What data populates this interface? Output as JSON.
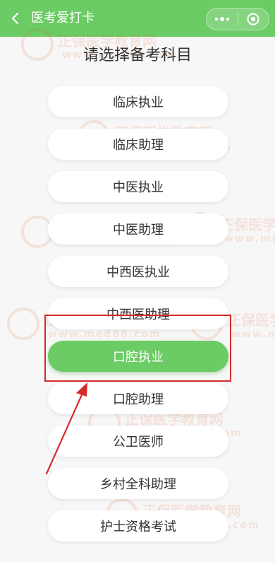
{
  "header": {
    "title": "医考爱打卡",
    "bg_color": "#6bcb64"
  },
  "page": {
    "heading": "请选择备考科目"
  },
  "watermark": {
    "line1": "正保医学教育网",
    "line2": "www.med66.com"
  },
  "subjects": [
    {
      "label": "临床执业",
      "selected": false
    },
    {
      "label": "临床助理",
      "selected": false
    },
    {
      "label": "中医执业",
      "selected": false
    },
    {
      "label": "中医助理",
      "selected": false
    },
    {
      "label": "中西医执业",
      "selected": false
    },
    {
      "label": "中西医助理",
      "selected": false
    },
    {
      "label": "口腔执业",
      "selected": true
    },
    {
      "label": "口腔助理",
      "selected": false
    },
    {
      "label": "公卫医师",
      "selected": false
    },
    {
      "label": "乡村全科助理",
      "selected": false
    },
    {
      "label": "护士资格考试",
      "selected": false
    }
  ],
  "annotation": {
    "color": "#d62b2b"
  }
}
